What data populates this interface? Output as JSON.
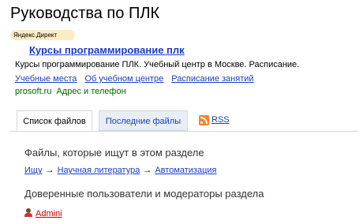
{
  "page": {
    "title": "Руководства по ПЛК"
  },
  "ad": {
    "badge": "Яндекс.Директ",
    "title": "Курсы программирование плк",
    "description": "Курсы программирование ПЛК. Учебный центр в Москве. Расписание.",
    "links": [
      "Учебные места",
      "Об учебном центре",
      "Расписание занятий"
    ],
    "site": "prosoft.ru",
    "contact": "Адрес и телефон"
  },
  "tabs": [
    {
      "label": "Список файлов",
      "active": true
    },
    {
      "label": "Последние файлы",
      "active": false
    }
  ],
  "rss": {
    "label": "RSS",
    "icon": "rss-icon"
  },
  "section": {
    "title": "Файлы, которые ищут в этом разделе",
    "breadcrumbs": [
      "Ищу",
      "Научная литература",
      "Автоматизация"
    ],
    "separator": "→"
  },
  "trusted": {
    "title": "Доверенные пользователи и модераторы раздела",
    "users": [
      {
        "name": "Admini",
        "icon": "user-icon"
      }
    ]
  }
}
